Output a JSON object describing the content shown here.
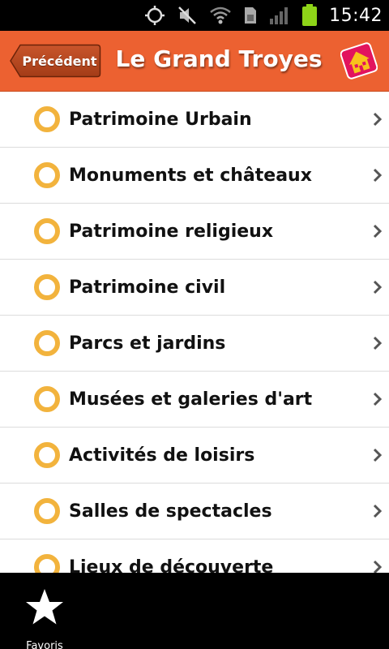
{
  "status_bar": {
    "time": "15:42",
    "icons": [
      "gps-icon",
      "mute-icon",
      "wifi-icon",
      "sim-icon",
      "signal-icon",
      "battery-icon"
    ]
  },
  "header": {
    "back_label": "Précédent",
    "title": "Le Grand Troyes",
    "logo_icon": "house-logo-icon",
    "background_color": "#ec6131"
  },
  "list": {
    "items": [
      {
        "label": "Patrimoine Urbain"
      },
      {
        "label": "Monuments et châteaux"
      },
      {
        "label": "Patrimoine religieux"
      },
      {
        "label": "Patrimoine civil"
      },
      {
        "label": "Parcs et jardins"
      },
      {
        "label": "Musées et galeries d'art"
      },
      {
        "label": "Activités de loisirs"
      },
      {
        "label": "Salles de spectacles"
      },
      {
        "label": "Lieux de découverte"
      }
    ],
    "bullet_color": "#f2b33d"
  },
  "bottom_bar": {
    "favorites_label": "Favoris",
    "favorites_icon": "star-icon"
  }
}
